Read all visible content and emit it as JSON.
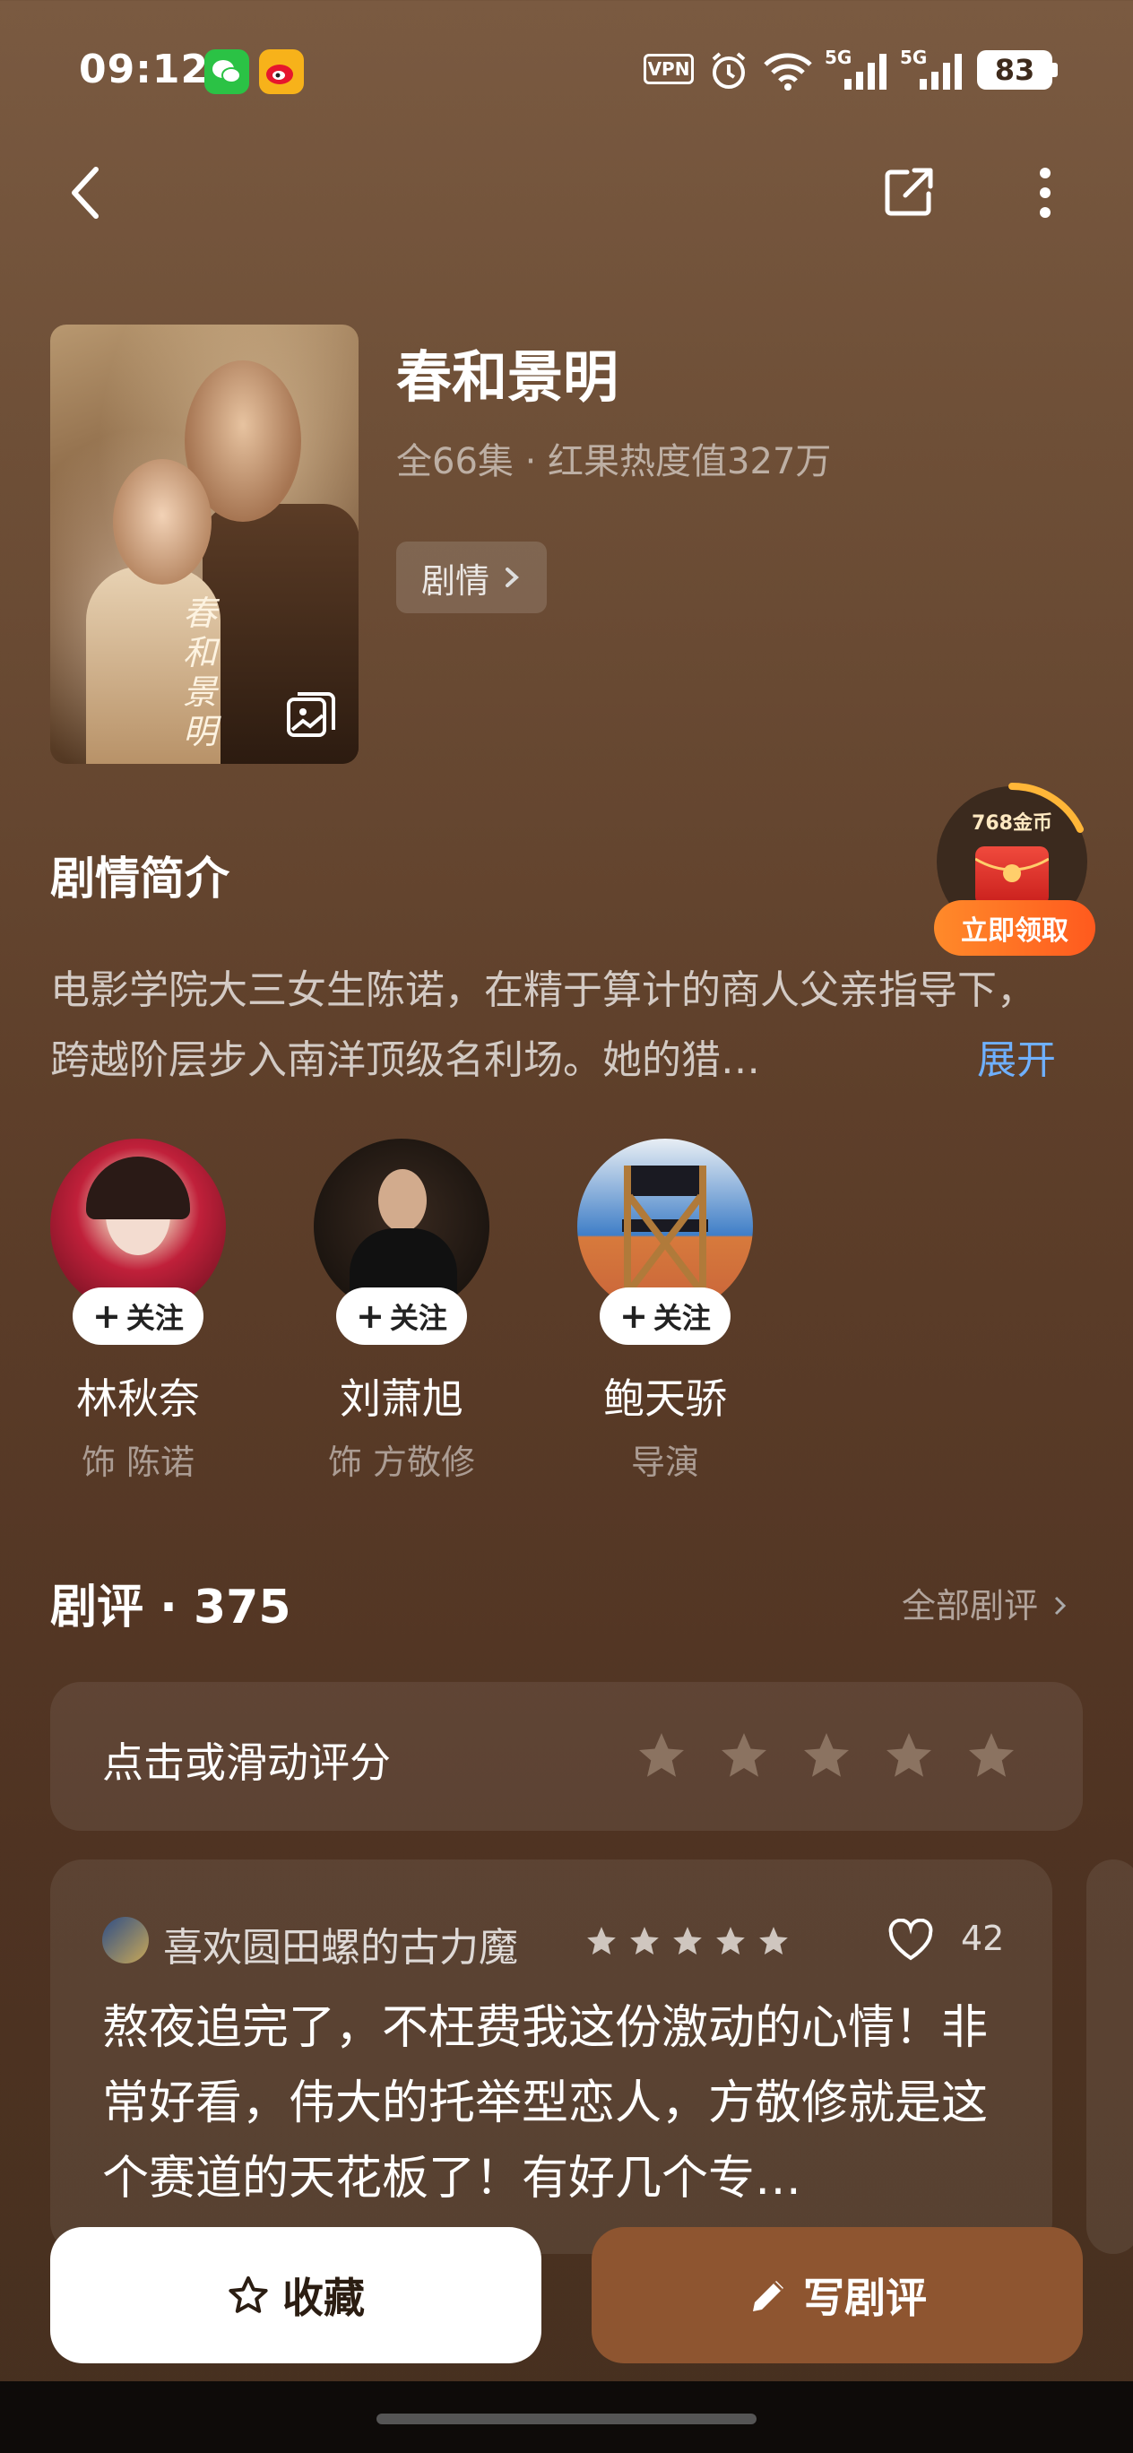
{
  "status_bar": {
    "time": "09:12",
    "vpn": "VPN",
    "net1": "5G",
    "net2": "5G",
    "battery": "83"
  },
  "show": {
    "title": "春和景明",
    "subtitle": "全66集 · 红果热度值327万",
    "genre_tag": "剧情",
    "poster_calligraphy": "春和景明"
  },
  "reward": {
    "coins": "768金币",
    "button": "立即领取"
  },
  "synopsis": {
    "title": "剧情简介",
    "text": "电影学院大三女生陈诺，在精于算计的商人父亲指导下，跨越阶层步入南洋顶级名利场。她的猎…",
    "expand": "展开"
  },
  "cast": [
    {
      "name": "林秋奈",
      "role": "饰 陈诺",
      "follow": "关注"
    },
    {
      "name": "刘萧旭",
      "role": "饰 方敬修",
      "follow": "关注"
    },
    {
      "name": "鲍天骄",
      "role": "导演",
      "follow": "关注"
    }
  ],
  "reviews": {
    "header": "剧评 · 375",
    "all_link": "全部剧评",
    "rate_prompt": "点击或滑动评分",
    "items": [
      {
        "user": "喜欢圆田螺的古力魔",
        "likes": "42",
        "rating": 5,
        "text": "熬夜追完了，不枉费我这份激动的心情！非常好看，伟大的托举型恋人，方敬修就是这个赛道的天花板了！有好几个专…"
      }
    ]
  },
  "actions": {
    "favorite": "收藏",
    "write_review": "写剧评"
  }
}
